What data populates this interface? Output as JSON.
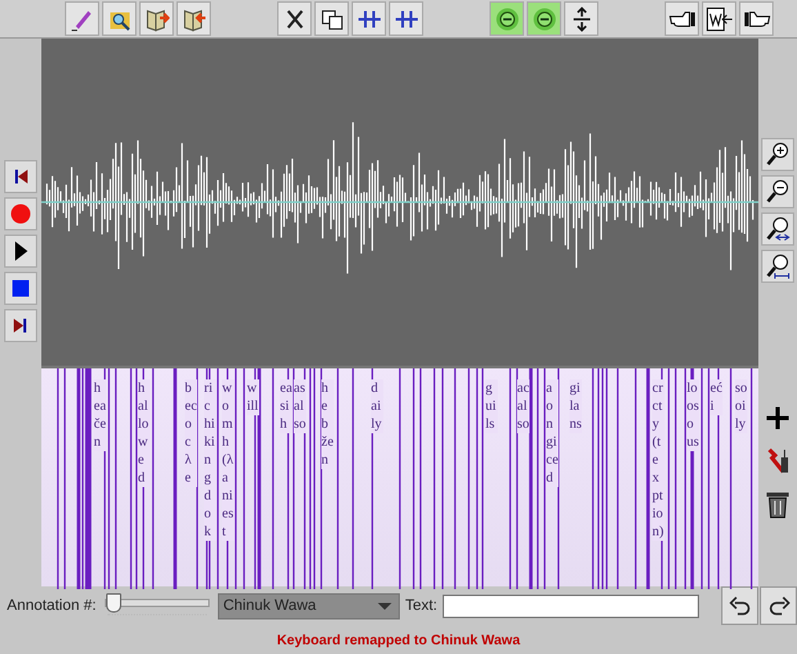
{
  "toolbar": [
    {
      "kind": "pen"
    },
    {
      "kind": "find"
    },
    {
      "kind": "book-out"
    },
    {
      "kind": "book-in"
    },
    {
      "kind": "cut"
    },
    {
      "kind": "copy"
    },
    {
      "kind": "split"
    },
    {
      "kind": "merge"
    },
    {
      "kind": "green"
    },
    {
      "kind": "green"
    },
    {
      "kind": "updown"
    },
    {
      "kind": "hand-left"
    },
    {
      "kind": "word"
    },
    {
      "kind": "hand-right"
    }
  ],
  "transport": [
    {
      "kind": "start"
    },
    {
      "kind": "record"
    },
    {
      "kind": "play"
    },
    {
      "kind": "stop"
    },
    {
      "kind": "end"
    }
  ],
  "zoom_tools": [
    {
      "kind": "zoom-in"
    },
    {
      "kind": "zoom-out"
    },
    {
      "kind": "zoom-fit"
    },
    {
      "kind": "zoom-range"
    }
  ],
  "annotation_tools": [
    {
      "kind": "add"
    },
    {
      "kind": "tools"
    },
    {
      "kind": "trash"
    }
  ],
  "annotations": [
    "heačen",
    "hallowed",
    "becocλe",
    "richikingdok",
    "womh(λaniest",
    "will",
    "easih",
    "asalso",
    "hebžen",
    "daily",
    "guils",
    "acalso",
    "aongiced",
    "gilans",
    "crcty(texption)",
    "loosous",
    "eći",
    "sooily"
  ],
  "annotation_slider": {
    "label": "Annotation #:",
    "level": 0
  },
  "language": {
    "value": "Chinuk Wawa"
  },
  "text_field": {
    "label": "Text:"
  },
  "history": [
    {
      "kind": "undo"
    },
    {
      "kind": "redo"
    }
  ],
  "status": "Keyboard remapped to Chinuk Wawa"
}
